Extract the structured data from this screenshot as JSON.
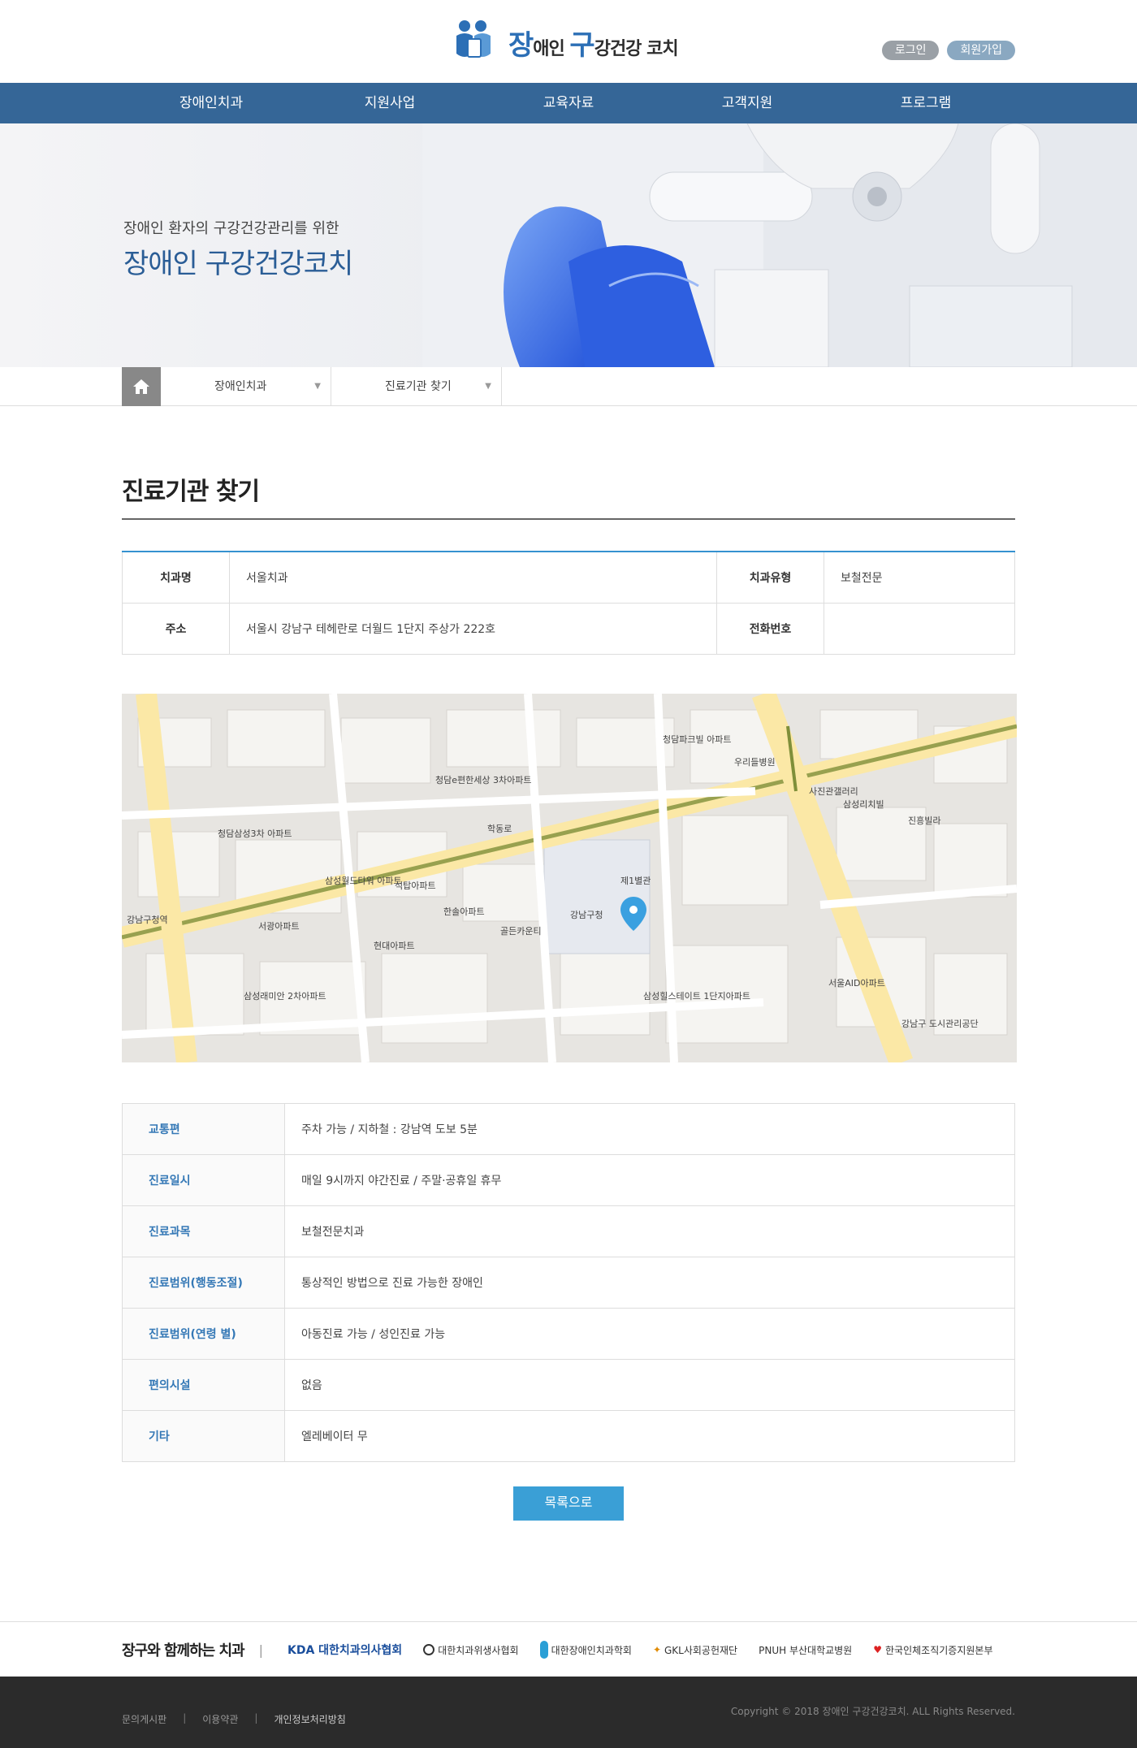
{
  "header": {
    "logo_big1": "장",
    "logo_small1": "애인 ",
    "logo_big2": "구",
    "logo_small2": "강건강 코치",
    "login": "로그인",
    "join": "회원가입"
  },
  "gnb": [
    "장애인치과",
    "지원사업",
    "교육자료",
    "고객지원",
    "프로그램"
  ],
  "visual": {
    "sub": "장애인 환자의 구강건강관리를 위한",
    "main": "장애인 구강건강코치"
  },
  "location": {
    "crumb1": "장애인치과",
    "crumb2": "진료기관 찾기"
  },
  "page_title": "진료기관 찾기",
  "info": {
    "name_label": "치과명",
    "name_value": "서울치과",
    "type_label": "치과유형",
    "type_value": "보철전문",
    "addr_label": "주소",
    "addr_value": "서울시 강남구 테헤란로 더월드 1단지 주상가 222호",
    "tel_label": "전화번호",
    "tel_value": ""
  },
  "map": {
    "labels": [
      "강남구청",
      "제1별관",
      "삼성월드타워 아파트",
      "현대아파트",
      "청담e편한세상 3차아파트",
      "학동로",
      "삼성리치빌",
      "청담삼성3차 아파트",
      "서울AID아파트",
      "강남구 도시관리공단",
      "우리들병원",
      "청담파크빌 아파트",
      "석탑아파트",
      "한솔아파트",
      "골든카운티",
      "삼성힐스테이트 1단지아파트",
      "진흥빌라",
      "삼성래미안 2차아파트",
      "서광아파트",
      "강남구청역",
      "사진관갤러리"
    ]
  },
  "detail": [
    {
      "label": "교통편",
      "value": "주차 가능 / 지하철 : 강남역 도보 5분"
    },
    {
      "label": "진료일시",
      "value": "매일 9시까지 야간진료 / 주말·공휴일 휴무"
    },
    {
      "label": "진료과목",
      "value": "보철전문치과"
    },
    {
      "label": "진료범위(행동조절)",
      "value": "통상적인 방법으로 진료 가능한 장애인"
    },
    {
      "label": "진료범위(연령 별)",
      "value": "아동진료 가능 / 성인진료 가능"
    },
    {
      "label": "편의시설",
      "value": "없음"
    },
    {
      "label": "기타",
      "value": "엘레베이터 무"
    }
  ],
  "list_button": "목록으로",
  "partners": {
    "title": "장구와 함께하는 치과",
    "bar": "|",
    "logos": [
      "KDA 대한치과의사협회",
      "대한치과위생사협회",
      "대한장애인치과학회",
      "GKL사회공헌재단",
      "PNUH 부산대학교병원",
      "한국인체조직기증지원본부"
    ]
  },
  "footer": {
    "links": [
      "문의게시판",
      "이용약관",
      "개인정보처리방침"
    ],
    "sep": "|",
    "copyright": "Copyright © 2018 장애인 구강건강코치.  ALL Rights Reserved."
  },
  "colors": {
    "gnb": "#356697",
    "accent": "#3a9fd6",
    "label_blue": "#3478b6"
  }
}
